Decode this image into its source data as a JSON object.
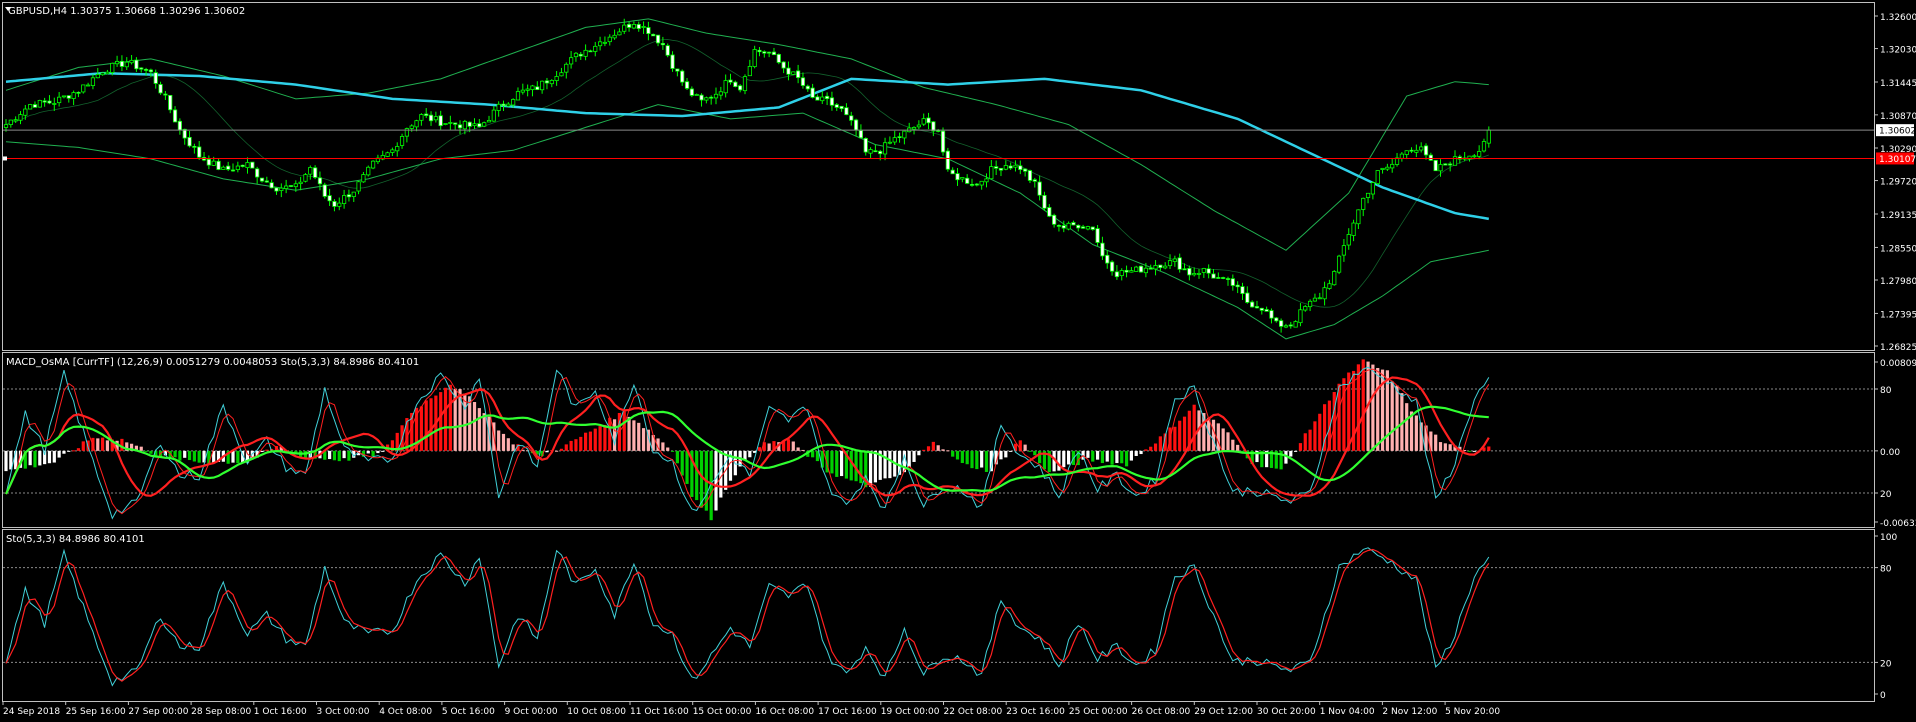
{
  "colors": {
    "background": "#000000",
    "frame": "#c0c0c0",
    "text": "#ffffff",
    "candle_up": "#00ff00",
    "candle_down": "#ffffff",
    "bollinger": "#20b050",
    "moving_average": "#2fd0e8",
    "price_line": "#ff0000",
    "bid_line": "#8a8a8a",
    "macd_up": "#ff1010",
    "macd_up_weak": "#ffb0b0",
    "macd_down": "#00d000",
    "macd_down_weak": "#ffffff",
    "sto_main": "#40d0d8",
    "sto_signal": "#ff2020",
    "overlay_red": "#ff2020",
    "overlay_green": "#30ff30"
  },
  "panels": {
    "main": {
      "title": "GBPUSD,H4  1.30375 1.30668 1.30296 1.30602",
      "price_labels": [
        "1.32600",
        "1.32030",
        "1.31445",
        "1.30870",
        "1.30290",
        "1.29720",
        "1.29135",
        "1.28550",
        "1.27980",
        "1.27395",
        "1.26825"
      ],
      "current_price_label": "1.30602",
      "line_price_label": "1.30107"
    },
    "macd": {
      "title": "MACD_OsMA [CurrTF] (12,26,9) 0.0051279 0.0048053  Sto(5,3,3) 84.8986 80.4101",
      "labels": [
        "0.008094",
        "80",
        "0.00",
        "20",
        "-0.006338"
      ]
    },
    "sto": {
      "title": "Sto(5,3,3) 84.8986 80.4101",
      "labels": [
        "100",
        "80",
        "20",
        "0"
      ]
    }
  },
  "time_labels": [
    "24 Sep 2018",
    "25 Sep 16:00",
    "27 Sep 00:00",
    "28 Sep 08:00",
    "1 Oct 16:00",
    "3 Oct 00:00",
    "4 Oct 08:00",
    "5 Oct 16:00",
    "9 Oct 00:00",
    "10 Oct 08:00",
    "11 Oct 16:00",
    "15 Oct 00:00",
    "16 Oct 08:00",
    "17 Oct 16:00",
    "19 Oct 00:00",
    "22 Oct 08:00",
    "23 Oct 16:00",
    "25 Oct 00:00",
    "26 Oct 08:00",
    "29 Oct 12:00",
    "30 Oct 20:00",
    "1 Nov 04:00",
    "2 Nov 12:00",
    "5 Nov 20:00"
  ],
  "chart_data": {
    "type": "candlestick",
    "symbol": "GBPUSD",
    "timeframe": "H4",
    "last_bar": {
      "open": 1.30375,
      "high": 1.30668,
      "low": 1.30296,
      "close": 1.30602
    },
    "y_range": [
      1.26825,
      1.326
    ],
    "horizontal_line": 1.30107,
    "close_anchors": [
      [
        0,
        1.307
      ],
      [
        5,
        1.3105
      ],
      [
        10,
        1.311
      ],
      [
        15,
        1.313
      ],
      [
        20,
        1.3165
      ],
      [
        25,
        1.318
      ],
      [
        30,
        1.316
      ],
      [
        33,
        1.3115
      ],
      [
        36,
        1.306
      ],
      [
        40,
        1.3015
      ],
      [
        45,
        1.299
      ],
      [
        50,
        1.3
      ],
      [
        53,
        1.2975
      ],
      [
        56,
        1.296
      ],
      [
        60,
        1.296
      ],
      [
        63,
        1.2995
      ],
      [
        66,
        1.2945
      ],
      [
        68,
        1.293
      ],
      [
        72,
        1.2955
      ],
      [
        76,
        1.3
      ],
      [
        80,
        1.3025
      ],
      [
        83,
        1.3065
      ],
      [
        86,
        1.3085
      ],
      [
        90,
        1.3075
      ],
      [
        94,
        1.307
      ],
      [
        98,
        1.3065
      ],
      [
        102,
        1.31
      ],
      [
        106,
        1.3125
      ],
      [
        110,
        1.3135
      ],
      [
        114,
        1.316
      ],
      [
        118,
        1.319
      ],
      [
        122,
        1.321
      ],
      [
        126,
        1.323
      ],
      [
        130,
        1.325
      ],
      [
        133,
        1.3235
      ],
      [
        136,
        1.321
      ],
      [
        138,
        1.3175
      ],
      [
        141,
        1.313
      ],
      [
        144,
        1.311
      ],
      [
        147,
        1.3125
      ],
      [
        150,
        1.315
      ],
      [
        152,
        1.3135
      ],
      [
        155,
        1.32
      ],
      [
        158,
        1.3195
      ],
      [
        161,
        1.317
      ],
      [
        164,
        1.315
      ],
      [
        167,
        1.3115
      ],
      [
        170,
        1.311
      ],
      [
        173,
        1.3095
      ],
      [
        176,
        1.306
      ],
      [
        178,
        1.302
      ],
      [
        181,
        1.3025
      ],
      [
        184,
        1.3045
      ],
      [
        187,
        1.306
      ],
      [
        190,
        1.3075
      ],
      [
        193,
        1.306
      ],
      [
        195,
        1.2985
      ],
      [
        198,
        1.2975
      ],
      [
        201,
        1.2965
      ],
      [
        204,
        1.299
      ],
      [
        207,
        1.3
      ],
      [
        210,
        1.2995
      ],
      [
        213,
        1.2965
      ],
      [
        216,
        1.2905
      ],
      [
        219,
        1.289
      ],
      [
        222,
        1.2895
      ],
      [
        225,
        1.289
      ],
      [
        227,
        1.284
      ],
      [
        230,
        1.281
      ],
      [
        234,
        1.2815
      ],
      [
        238,
        1.2825
      ],
      [
        242,
        1.283
      ],
      [
        245,
        1.281
      ],
      [
        248,
        1.2815
      ],
      [
        251,
        1.28
      ],
      [
        254,
        1.279
      ],
      [
        257,
        1.276
      ],
      [
        260,
        1.275
      ],
      [
        263,
        1.272
      ],
      [
        266,
        1.272
      ],
      [
        269,
        1.275
      ],
      [
        272,
        1.277
      ],
      [
        275,
        1.281
      ],
      [
        278,
        1.288
      ],
      [
        281,
        1.294
      ],
      [
        284,
        1.2985
      ],
      [
        287,
        1.3
      ],
      [
        290,
        1.303
      ],
      [
        293,
        1.3025
      ],
      [
        296,
        1.299
      ],
      [
        299,
        1.3005
      ],
      [
        302,
        1.3015
      ],
      [
        305,
        1.3025
      ],
      [
        307,
        1.306
      ]
    ],
    "moving_average_anchors": [
      [
        0,
        1.3145
      ],
      [
        20,
        1.316
      ],
      [
        40,
        1.3155
      ],
      [
        60,
        1.314
      ],
      [
        80,
        1.3115
      ],
      [
        100,
        1.3105
      ],
      [
        120,
        1.309
      ],
      [
        140,
        1.3085
      ],
      [
        160,
        1.31
      ],
      [
        175,
        1.315
      ],
      [
        195,
        1.314
      ],
      [
        215,
        1.315
      ],
      [
        235,
        1.313
      ],
      [
        255,
        1.308
      ],
      [
        270,
        1.302
      ],
      [
        285,
        1.296
      ],
      [
        300,
        1.2915
      ],
      [
        307,
        1.2905
      ]
    ],
    "bollinger_upper_anchors": [
      [
        0,
        1.313
      ],
      [
        15,
        1.317
      ],
      [
        30,
        1.3185
      ],
      [
        45,
        1.3155
      ],
      [
        60,
        1.3115
      ],
      [
        75,
        1.3125
      ],
      [
        90,
        1.315
      ],
      [
        105,
        1.3195
      ],
      [
        120,
        1.324
      ],
      [
        133,
        1.3255
      ],
      [
        145,
        1.323
      ],
      [
        160,
        1.321
      ],
      [
        175,
        1.3185
      ],
      [
        190,
        1.3135
      ],
      [
        205,
        1.3105
      ],
      [
        220,
        1.307
      ],
      [
        235,
        1.3
      ],
      [
        250,
        1.292
      ],
      [
        265,
        1.285
      ],
      [
        278,
        1.295
      ],
      [
        290,
        1.312
      ],
      [
        300,
        1.3145
      ],
      [
        307,
        1.314
      ]
    ],
    "bollinger_lower_anchors": [
      [
        0,
        1.304
      ],
      [
        15,
        1.303
      ],
      [
        30,
        1.301
      ],
      [
        45,
        1.2975
      ],
      [
        60,
        1.2955
      ],
      [
        75,
        1.2975
      ],
      [
        90,
        1.301
      ],
      [
        105,
        1.3025
      ],
      [
        120,
        1.3065
      ],
      [
        135,
        1.3105
      ],
      [
        150,
        1.308
      ],
      [
        165,
        1.309
      ],
      [
        180,
        1.3035
      ],
      [
        195,
        1.301
      ],
      [
        210,
        1.295
      ],
      [
        225,
        1.286
      ],
      [
        240,
        1.281
      ],
      [
        255,
        1.275
      ],
      [
        265,
        1.2695
      ],
      [
        275,
        1.272
      ],
      [
        285,
        1.277
      ],
      [
        295,
        1.283
      ],
      [
        307,
        1.285
      ]
    ],
    "macd_histogram_anchors": [
      [
        0,
        -0.0018
      ],
      [
        10,
        -0.001
      ],
      [
        18,
        0.0012
      ],
      [
        24,
        0.001
      ],
      [
        32,
        -0.0005
      ],
      [
        40,
        -0.001
      ],
      [
        50,
        -0.001
      ],
      [
        56,
        0.0004
      ],
      [
        62,
        -0.0006
      ],
      [
        70,
        -0.0008
      ],
      [
        78,
        -0.0002
      ],
      [
        84,
        0.0035
      ],
      [
        92,
        0.006
      ],
      [
        98,
        0.004
      ],
      [
        104,
        0.001
      ],
      [
        110,
        -0.0005
      ],
      [
        116,
        0.0005
      ],
      [
        122,
        0.002
      ],
      [
        128,
        0.0035
      ],
      [
        134,
        0.0015
      ],
      [
        138,
        0.0
      ],
      [
        142,
        -0.004
      ],
      [
        146,
        -0.006
      ],
      [
        150,
        -0.0025
      ],
      [
        156,
        0.0005
      ],
      [
        162,
        0.001
      ],
      [
        170,
        -0.0018
      ],
      [
        178,
        -0.0032
      ],
      [
        186,
        -0.002
      ],
      [
        192,
        0.001
      ],
      [
        198,
        -0.0012
      ],
      [
        204,
        -0.0018
      ],
      [
        210,
        0.001
      ],
      [
        216,
        -0.002
      ],
      [
        224,
        -0.0008
      ],
      [
        232,
        -0.0012
      ],
      [
        240,
        0.0015
      ],
      [
        246,
        0.004
      ],
      [
        252,
        0.002
      ],
      [
        258,
        -0.001
      ],
      [
        264,
        -0.0018
      ],
      [
        270,
        0.002
      ],
      [
        276,
        0.006
      ],
      [
        281,
        0.008
      ],
      [
        286,
        0.007
      ],
      [
        292,
        0.003
      ],
      [
        298,
        0.0005
      ],
      [
        304,
        0.0
      ],
      [
        307,
        0.0005
      ]
    ],
    "stochastic_anchors": [
      [
        0,
        22
      ],
      [
        4,
        65
      ],
      [
        8,
        45
      ],
      [
        12,
        88
      ],
      [
        18,
        38
      ],
      [
        22,
        8
      ],
      [
        27,
        14
      ],
      [
        32,
        50
      ],
      [
        36,
        30
      ],
      [
        40,
        30
      ],
      [
        45,
        70
      ],
      [
        50,
        38
      ],
      [
        54,
        50
      ],
      [
        58,
        35
      ],
      [
        62,
        30
      ],
      [
        66,
        80
      ],
      [
        70,
        45
      ],
      [
        75,
        38
      ],
      [
        80,
        40
      ],
      [
        85,
        72
      ],
      [
        90,
        88
      ],
      [
        95,
        70
      ],
      [
        98,
        88
      ],
      [
        102,
        18
      ],
      [
        106,
        50
      ],
      [
        110,
        35
      ],
      [
        114,
        92
      ],
      [
        118,
        68
      ],
      [
        122,
        80
      ],
      [
        126,
        50
      ],
      [
        130,
        85
      ],
      [
        134,
        45
      ],
      [
        138,
        38
      ],
      [
        142,
        8
      ],
      [
        146,
        24
      ],
      [
        150,
        42
      ],
      [
        154,
        30
      ],
      [
        158,
        68
      ],
      [
        162,
        62
      ],
      [
        166,
        70
      ],
      [
        170,
        25
      ],
      [
        174,
        12
      ],
      [
        178,
        30
      ],
      [
        182,
        10
      ],
      [
        186,
        42
      ],
      [
        190,
        12
      ],
      [
        194,
        25
      ],
      [
        198,
        22
      ],
      [
        202,
        12
      ],
      [
        206,
        60
      ],
      [
        210,
        42
      ],
      [
        214,
        35
      ],
      [
        218,
        18
      ],
      [
        222,
        46
      ],
      [
        226,
        22
      ],
      [
        230,
        30
      ],
      [
        234,
        18
      ],
      [
        238,
        28
      ],
      [
        242,
        75
      ],
      [
        246,
        80
      ],
      [
        250,
        50
      ],
      [
        254,
        20
      ],
      [
        258,
        22
      ],
      [
        262,
        18
      ],
      [
        266,
        15
      ],
      [
        270,
        20
      ],
      [
        276,
        80
      ],
      [
        281,
        92
      ],
      [
        286,
        85
      ],
      [
        292,
        72
      ],
      [
        296,
        15
      ],
      [
        300,
        38
      ],
      [
        304,
        75
      ],
      [
        307,
        85
      ]
    ]
  }
}
